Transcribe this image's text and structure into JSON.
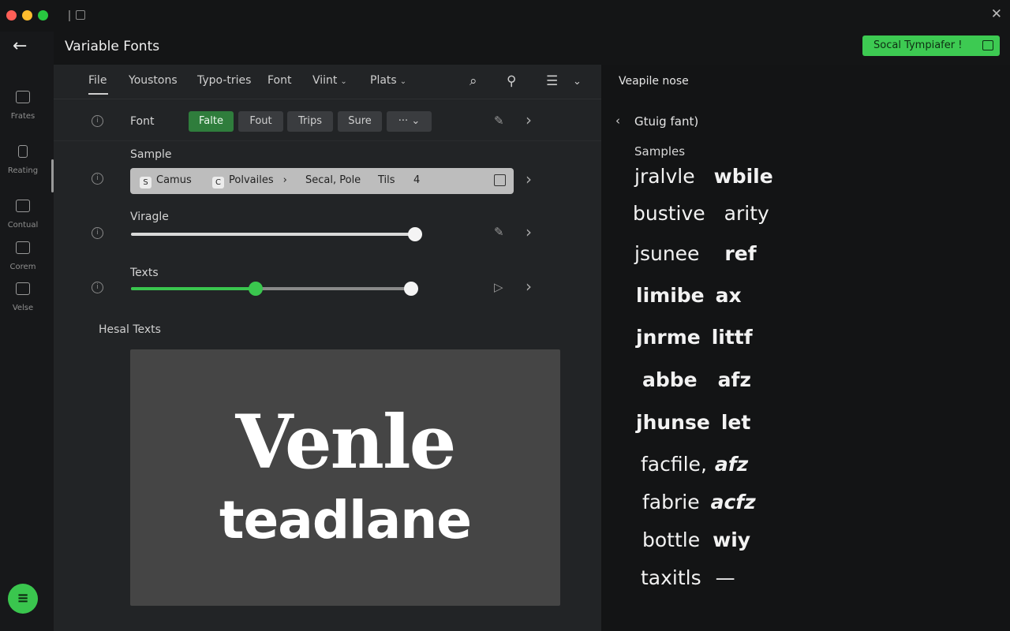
{
  "app": {
    "title": "Variable Fonts",
    "cta_label": "Socal Tympiafer  !"
  },
  "rail": {
    "items": [
      {
        "label": "Frates",
        "icon": "document-icon"
      },
      {
        "label": "Reating",
        "icon": "file-icon"
      },
      {
        "label": "Contual",
        "icon": "panels-icon"
      },
      {
        "label": "Corem",
        "icon": "layers-icon"
      },
      {
        "label": "Velse",
        "icon": "copy-icon"
      }
    ]
  },
  "menu": {
    "items": [
      {
        "label": "File"
      },
      {
        "label": "Youstons"
      },
      {
        "label": "Typo-tries"
      },
      {
        "label": "Font"
      },
      {
        "label": "Viint",
        "caret": "⌄"
      },
      {
        "label": "Plats",
        "caret": "⌄"
      }
    ]
  },
  "font_row": {
    "label": "Font",
    "chips": [
      "Falte",
      "Fout",
      "Trips",
      "Sure",
      "···"
    ],
    "active_chip": "Falte"
  },
  "sample_row": {
    "label": "Sample",
    "items": [
      {
        "badge": "S",
        "text": "Camus"
      },
      {
        "badge": "C",
        "text": "Polvailes"
      },
      {
        "badge": "",
        "text": "Secal, Pole"
      },
      {
        "badge": "",
        "text": "Tils"
      },
      {
        "badge": "",
        "text": "4"
      }
    ]
  },
  "virage_row": {
    "label": "Viragle",
    "value": 1.0
  },
  "texts_row": {
    "label": "Texts",
    "low": 0.43,
    "high": 1.0
  },
  "preview": {
    "title": "Hesal Texts",
    "line1": "Venle",
    "line2": "teadlane"
  },
  "right_panel": {
    "title": "Veapile nose",
    "back_label": "Gtuig fant)",
    "samples_label": "Samples",
    "specimens": [
      {
        "a": "jralvle",
        "b": "wbile"
      },
      {
        "a": "bustive",
        "b": "arity"
      },
      {
        "a": "jsunee",
        "b": "ref"
      },
      {
        "a": "limibe",
        "b": "ax"
      },
      {
        "a": "jnrme",
        "b": "littf"
      },
      {
        "a": "abbe",
        "b": "afz"
      },
      {
        "a": "jhunse",
        "b": "let"
      },
      {
        "a": "facfile,",
        "b": "afz"
      },
      {
        "a": "fabrie",
        "b": "acfz"
      },
      {
        "a": "bottle",
        "b": "wiy"
      },
      {
        "a": "taxitls",
        "b": "—"
      }
    ]
  }
}
